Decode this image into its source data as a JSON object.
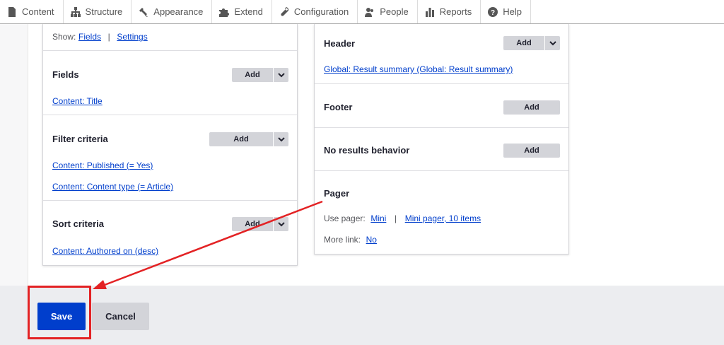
{
  "toolbar": {
    "items": [
      {
        "label": "Content",
        "icon": "content-icon"
      },
      {
        "label": "Structure",
        "icon": "structure-icon"
      },
      {
        "label": "Appearance",
        "icon": "appearance-icon"
      },
      {
        "label": "Extend",
        "icon": "extend-icon"
      },
      {
        "label": "Configuration",
        "icon": "configuration-icon"
      },
      {
        "label": "People",
        "icon": "people-icon"
      },
      {
        "label": "Reports",
        "icon": "reports-icon"
      },
      {
        "label": "Help",
        "icon": "help-icon"
      }
    ]
  },
  "show": {
    "label": "Show:",
    "fields_link": "Fields",
    "separator": "|",
    "settings_link": "Settings"
  },
  "left": {
    "fields": {
      "title": "Fields",
      "add": "Add",
      "items": [
        "Content: Title"
      ]
    },
    "filter": {
      "title": "Filter criteria",
      "add": "Add",
      "items": [
        "Content: Published (= Yes)",
        "Content: Content type (= Article)"
      ]
    },
    "sort": {
      "title": "Sort criteria",
      "add": "Add",
      "items": [
        "Content: Authored on (desc)"
      ]
    }
  },
  "right": {
    "header": {
      "title": "Header",
      "add": "Add",
      "items": [
        "Global: Result summary (Global: Result summary)"
      ]
    },
    "footer": {
      "title": "Footer",
      "add": "Add"
    },
    "no_results": {
      "title": "No results behavior",
      "add": "Add"
    },
    "pager": {
      "title": "Pager",
      "use_pager_label": "Use pager:",
      "use_pager_value": "Mini",
      "separator": "|",
      "use_pager_settings": "Mini pager, 10 items",
      "more_link_label": "More link:",
      "more_link_value": "No"
    }
  },
  "actions": {
    "save": "Save",
    "cancel": "Cancel"
  },
  "colors": {
    "primary": "#003ecc",
    "highlight": "#e32224",
    "button_gray": "#d3d4d9"
  }
}
